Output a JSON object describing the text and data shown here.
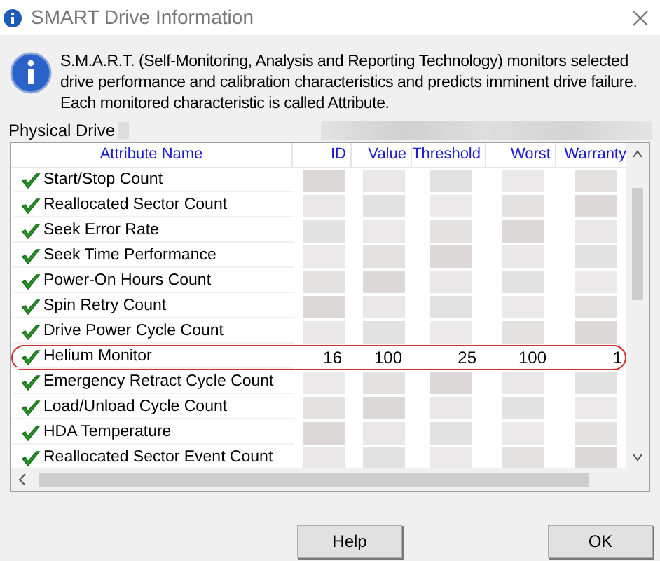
{
  "window": {
    "title": "SMART Drive Information"
  },
  "description": "S.M.A.R.T. (Self-Monitoring, Analysis and Reporting Technology) monitors selected drive performance and calibration characteristics and predicts imminent drive failure. Each monitored characteristic is called Attribute.",
  "physical_drive": {
    "label": "Physical Drive",
    "redacted": true
  },
  "table": {
    "columns": [
      "Attribute Name",
      "ID",
      "Value",
      "Threshold",
      "Worst",
      "Warranty"
    ],
    "rows": [
      {
        "name": "Start/Stop Count",
        "ok": true,
        "redacted": true,
        "highlighted": false
      },
      {
        "name": "Reallocated Sector Count",
        "ok": true,
        "redacted": true,
        "highlighted": false
      },
      {
        "name": "Seek Error Rate",
        "ok": true,
        "redacted": true,
        "highlighted": false
      },
      {
        "name": "Seek Time Performance",
        "ok": true,
        "redacted": true,
        "highlighted": false
      },
      {
        "name": "Power-On Hours Count",
        "ok": true,
        "redacted": true,
        "highlighted": false
      },
      {
        "name": "Spin Retry Count",
        "ok": true,
        "redacted": true,
        "highlighted": false
      },
      {
        "name": "Drive Power Cycle Count",
        "ok": true,
        "redacted": true,
        "highlighted": false
      },
      {
        "name": "Helium Monitor",
        "ok": true,
        "redacted": false,
        "highlighted": true,
        "values": [
          "16",
          "100",
          "25",
          "100",
          "1"
        ]
      },
      {
        "name": "Emergency Retract Cycle Count",
        "ok": true,
        "redacted": true,
        "highlighted": false
      },
      {
        "name": "Load/Unload Cycle Count",
        "ok": true,
        "redacted": true,
        "highlighted": false
      },
      {
        "name": "HDA Temperature",
        "ok": true,
        "redacted": true,
        "highlighted": false
      },
      {
        "name": "Reallocated Sector Event Count",
        "ok": true,
        "redacted": true,
        "highlighted": false
      }
    ]
  },
  "buttons": [
    "Help",
    "OK"
  ]
}
